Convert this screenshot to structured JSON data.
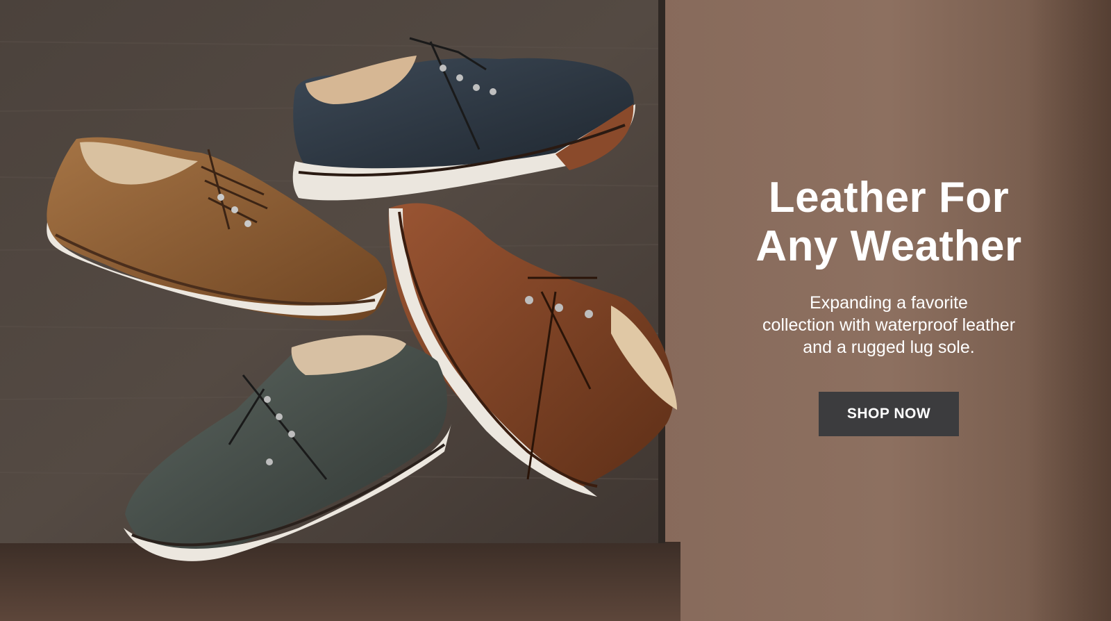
{
  "banner": {
    "headline_line1": "Leather For",
    "headline_line2": "Any Weather",
    "subcopy_line1": "Expanding a favorite",
    "subcopy_line2": "collection with waterproof leather",
    "subcopy_line3": "and a rugged lug sole.",
    "cta_label": "SHOP NOW",
    "image_alt": "Four leather shoes on a dark wooden board: tan oxford, navy oxford, brown chukka, gray chukka"
  },
  "colors": {
    "background": "#86695a",
    "board": "#4a4039",
    "cta_background": "#3c3c3e",
    "text": "#ffffff"
  }
}
